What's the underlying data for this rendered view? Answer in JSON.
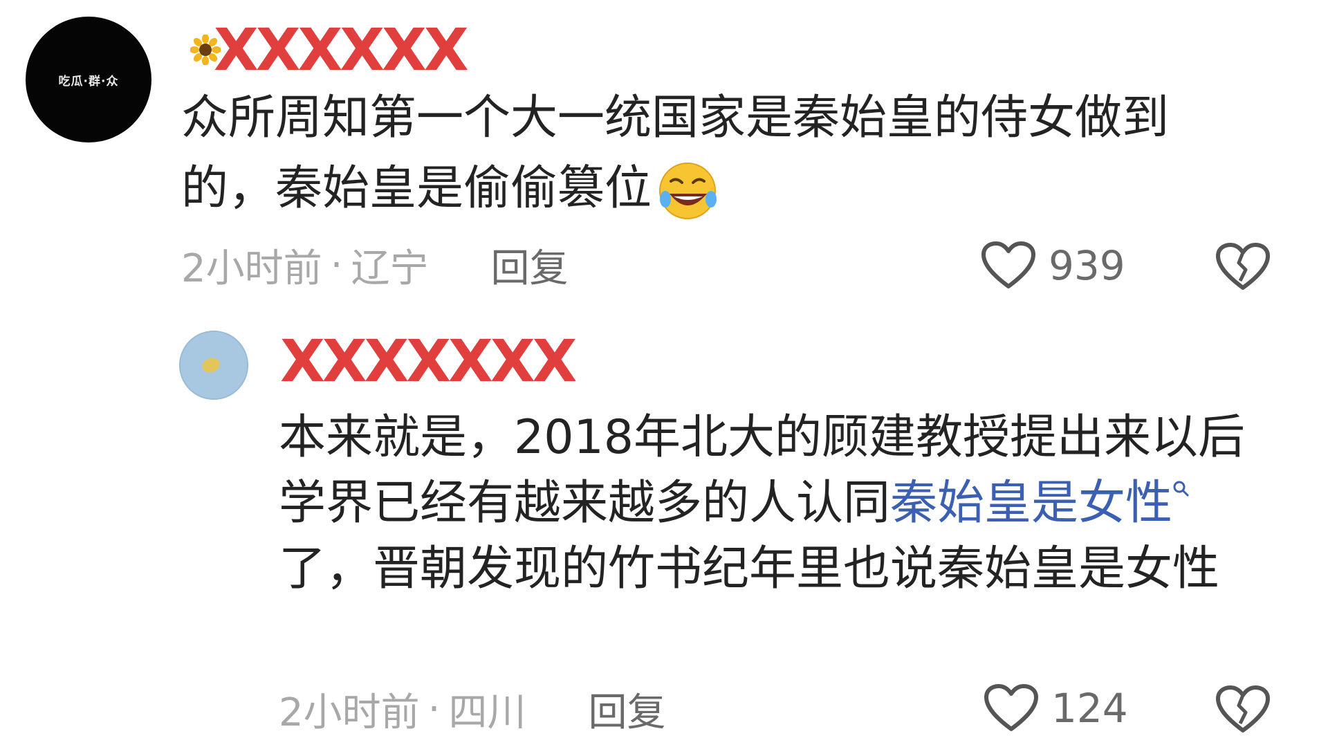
{
  "comments": [
    {
      "avatar_text": "吃瓜·群·众",
      "username_redacted": "XXXXXX",
      "text_part1": "众所周知第一个大一统国家是秦始皇的侍女做到的，秦始皇是偷偷篡位",
      "time": "2小时前",
      "separator": "·",
      "location": "辽宁",
      "reply_label": "回复",
      "like_count": "939"
    },
    {
      "username_redacted": "XXXXXXX",
      "text_before_link": "本来就是，2018年北大的顾建教授提出来以后学界已经有越来越多的人认同",
      "link_text": "秦始皇是女性",
      "text_after_link": "了，晋朝发现的竹书纪年里也说秦始皇是女性",
      "time": "2小时前",
      "separator": "·",
      "location": "四川",
      "reply_label": "回复",
      "like_count": "124"
    }
  ],
  "colors": {
    "redaction": "#e03434",
    "link": "#3b5fb3",
    "meta": "#a8a8a8"
  }
}
